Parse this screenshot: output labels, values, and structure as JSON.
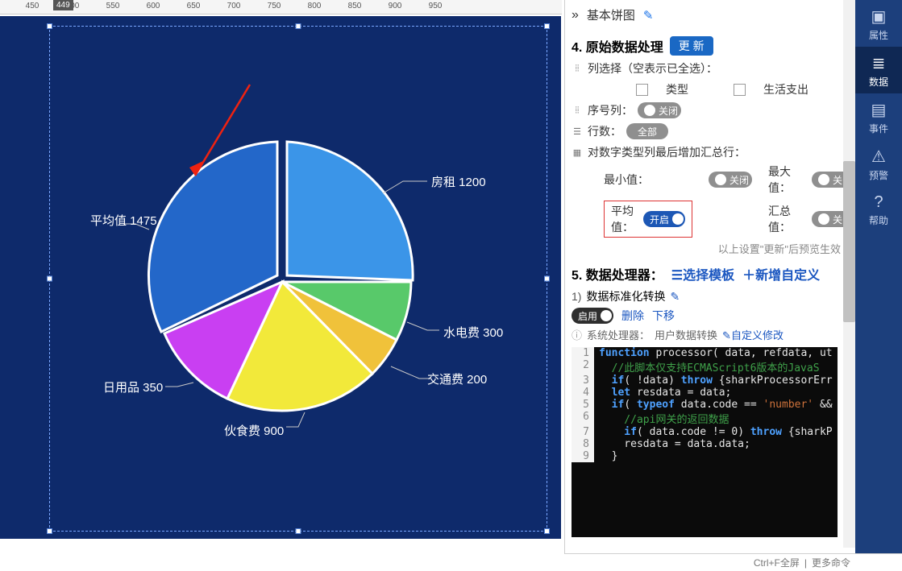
{
  "panel": {
    "title": "基本饼图",
    "section4": "4. 原始数据处理",
    "refresh": "更 新",
    "colSelect": "列选择（空表示已全选）：",
    "col1": "类型",
    "col2": "生活支出",
    "seqCol": "序号列：",
    "closed": "关闭",
    "rowCount": "行数：",
    "all": "全部",
    "aggLine": "对数字类型列最后增加汇总行：",
    "min": "最小值：",
    "max": "最大值：",
    "avg": "平均值：",
    "open": "开启",
    "sum": "汇总值：",
    "note": "以上设置\"更新\"后预览生效",
    "section5": "5. 数据处理器：",
    "tpl": "选择模板",
    "addCustom": "＋新增自定义",
    "p1num": "1)",
    "p1name": "数据标准化转换",
    "enable": "启用",
    "del": "删除",
    "down": "下移",
    "sysP": "系统处理器：",
    "userTrans": "用户数据转换",
    "customEdit": "自定义修改"
  },
  "rail": {
    "r1": "属性",
    "r2": "数据",
    "r3": "事件",
    "r4": "预警",
    "r5": "帮助"
  },
  "status": {
    "fs": "Ctrl+F全屏",
    "more": "更多命令"
  },
  "ruler": {
    "badge": "449"
  },
  "chart_data": {
    "type": "pie",
    "title": "",
    "series": [
      {
        "name": "房租",
        "value": 1200,
        "label": "房租 1200"
      },
      {
        "name": "水电费",
        "value": 300,
        "label": "水电费 300"
      },
      {
        "name": "交通费",
        "value": 200,
        "label": "交通费 200"
      },
      {
        "name": "伙食费",
        "value": 900,
        "label": "伙食费 900"
      },
      {
        "name": "日用品",
        "value": 350,
        "label": "日用品 350"
      },
      {
        "name": "平均值",
        "value": 1475,
        "label": "平均值 1475"
      }
    ],
    "colors": [
      "#3b95e8",
      "#58c96a",
      "#f4d13d",
      "#f2e93a",
      "#e93ff2",
      "#2367c9"
    ]
  },
  "code": {
    "l1a": "function",
    "l1b": " processor( data, refdata, ut",
    "l2": "  //此脚本仅支持ECMAScript6版本的JavaS",
    "l3a": "  if",
    "l3b": "( !data) ",
    "l3c": "throw",
    "l3d": " {sharkProcessorErr",
    "l4a": "  let",
    "l4b": " resdata = data;",
    "l5a": "  if",
    "l5b": "( ",
    "l5c": "typeof",
    "l5d": " data.code == ",
    "l5e": "'number'",
    "l5f": " &&",
    "l6": "    //api网关的返回数据",
    "l7a": "    if",
    "l7b": "( data.code != 0) ",
    "l7c": "throw",
    "l7d": " {sharkP",
    "l8": "    resdata = data.data;",
    "l9": "  }"
  }
}
